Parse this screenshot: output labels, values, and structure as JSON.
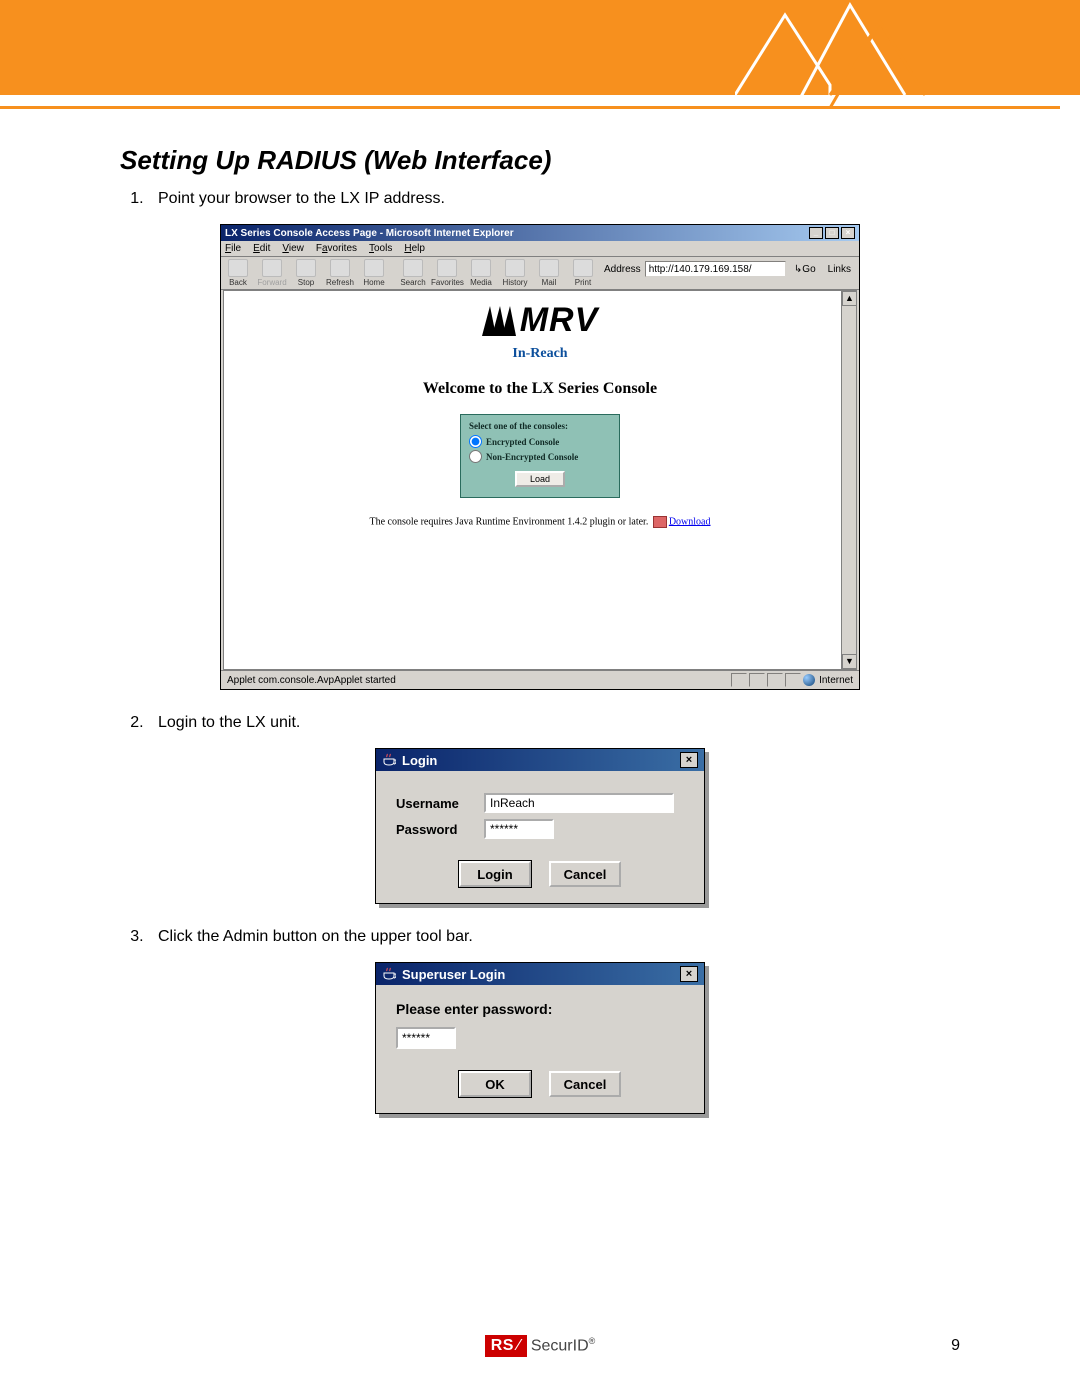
{
  "header": {
    "brand": "RSA",
    "product": "SecurID"
  },
  "title": "Setting Up RADIUS (Web Interface)",
  "steps": [
    "Point your browser to the LX IP address.",
    "Login to the LX unit.",
    "Click the Admin button on the upper tool bar."
  ],
  "page_number": "9",
  "ie": {
    "window_title": "LX Series Console Access Page - Microsoft Internet Explorer",
    "menus": {
      "file": "File",
      "edit": "Edit",
      "view": "View",
      "favorites": "Favorites",
      "tools": "Tools",
      "help": "Help"
    },
    "toolbar": {
      "back": "Back",
      "forward": "Forward",
      "stop": "Stop",
      "refresh": "Refresh",
      "home": "Home",
      "search": "Search",
      "favorites": "Favorites",
      "media": "Media",
      "history": "History",
      "mail": "Mail",
      "print": "Print"
    },
    "address_label": "Address",
    "address_value": "http://140.179.169.158/",
    "go_label": "Go",
    "links_label": "Links",
    "brand": "MRV",
    "subbrand": "In-Reach",
    "welcome": "Welcome to the LX Series Console",
    "console_box": {
      "header": "Select one of the consoles:",
      "encrypted": "Encrypted Console",
      "nonencrypted": "Non-Encrypted Console",
      "load": "Load"
    },
    "java_note_pre": "The console requires Java Runtime Environment 1.4.2 plugin or later. ",
    "java_note_link": "Download",
    "status_left": "Applet com.console.AvpApplet started",
    "status_right": "Internet"
  },
  "login_dialog": {
    "title": "Login",
    "username_label": "Username",
    "username_value": "InReach",
    "password_label": "Password",
    "password_value": "******",
    "login_btn": "Login",
    "cancel_btn": "Cancel"
  },
  "su_dialog": {
    "title": "Superuser Login",
    "prompt": "Please enter password:",
    "password_value": "******",
    "ok_btn": "OK",
    "cancel_btn": "Cancel"
  }
}
